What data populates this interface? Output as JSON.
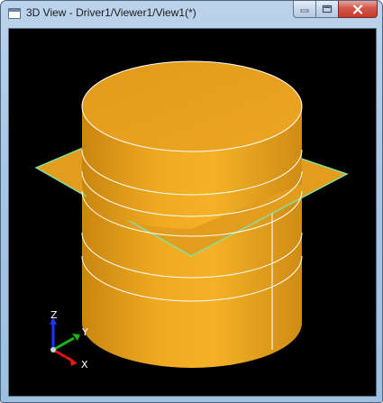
{
  "window": {
    "title": "3D View - Driver1/Viewer1/View1(*)"
  },
  "caption_buttons": {
    "minimize_icon": "minimize-icon",
    "restore_icon": "restore-icon",
    "close_icon": "close-icon"
  },
  "viewport": {
    "background": "#000000",
    "model": {
      "body_color": "#e9a01c",
      "edge_color": "#ffffff",
      "plane_edge_color": "#7fe3a8"
    },
    "triad": {
      "z_label": "Z",
      "y_label": "Y",
      "x_label": "X",
      "z_color": "#1a35ff",
      "y_color": "#1bb31b",
      "x_color": "#e01515"
    }
  }
}
